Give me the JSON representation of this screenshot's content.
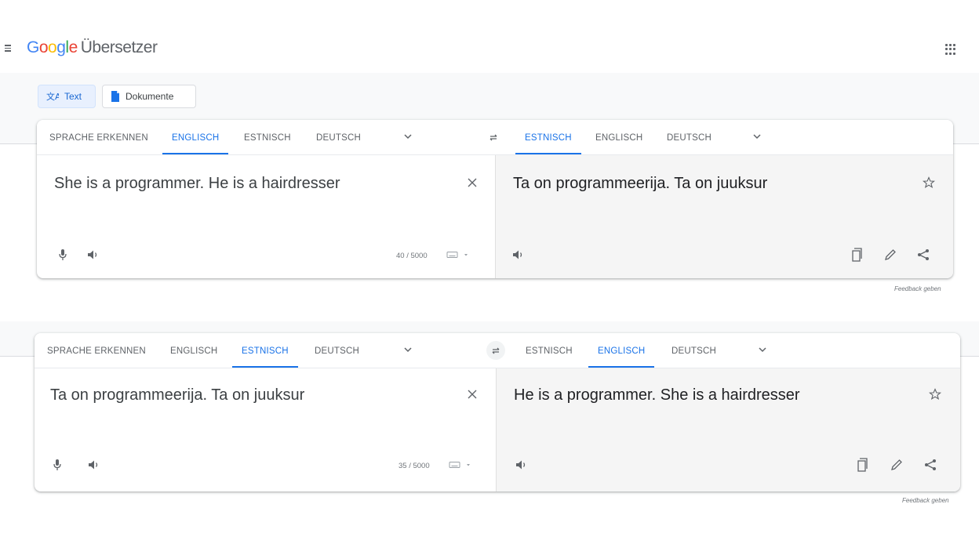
{
  "app": {
    "logo_letters": [
      "G",
      "o",
      "o",
      "g",
      "l",
      "e"
    ],
    "title": "Übersetzer",
    "menu_icon": "hamburger-menu-icon",
    "apps_icon": "apps-grid-icon"
  },
  "modes": [
    {
      "label": "Text",
      "icon": "translate-icon",
      "active": true
    },
    {
      "label": "Dokumente",
      "icon": "document-icon",
      "active": false
    }
  ],
  "panels": [
    {
      "source_langs": [
        "SPRACHE ERKENNEN",
        "ENGLISCH",
        "ESTNISCH",
        "DEUTSCH"
      ],
      "source_active": 1,
      "target_langs": [
        "ESTNISCH",
        "ENGLISCH",
        "DEUTSCH"
      ],
      "target_active": 0,
      "source_text": "She is a programmer. He is a hairdresser",
      "target_text": "Ta on programmeerija. Ta on juuksur",
      "char_count": "40 / 5000",
      "feedback": "Feedback geben"
    },
    {
      "source_langs": [
        "SPRACHE ERKENNEN",
        "ENGLISCH",
        "ESTNISCH",
        "DEUTSCH"
      ],
      "source_active": 2,
      "target_langs": [
        "ESTNISCH",
        "ENGLISCH",
        "DEUTSCH"
      ],
      "target_active": 1,
      "source_text": "Ta on programmeerija. Ta on juuksur",
      "target_text": "He is a programmer. She is a hairdresser",
      "char_count": "35 / 5000",
      "feedback": "Feedback geben"
    }
  ],
  "colors": {
    "accent": "#1a73e8",
    "target_bg": "#f5f5f5",
    "band": "#f8f9fa"
  }
}
